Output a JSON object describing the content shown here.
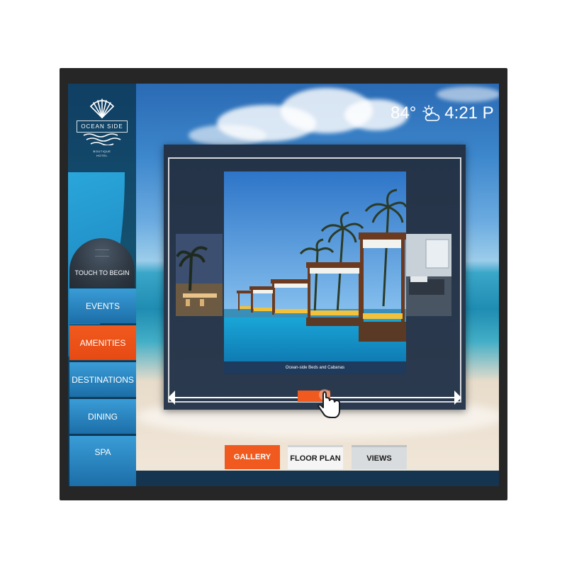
{
  "brand": {
    "name": "OCEAN SIDE",
    "subtitle_line1": "BOUTIQUE",
    "subtitle_line2": "HOTEL"
  },
  "header": {
    "temperature": "84°",
    "weather_icon": "partly-cloudy-icon",
    "time": "4:21 P"
  },
  "sidebar": {
    "touch_to_begin": "TOUCH TO BEGIN",
    "items": [
      {
        "label": "EVENTS",
        "active": false
      },
      {
        "label": "AMENITIES",
        "active": true
      },
      {
        "label": "DESTINATIONS",
        "active": false
      },
      {
        "label": "DINING",
        "active": false
      },
      {
        "label": "SPA",
        "active": false
      }
    ]
  },
  "gallery": {
    "caption": "Ocean-side Beds and Cabanas"
  },
  "tabs": [
    {
      "label": "GALLERY",
      "active": true
    },
    {
      "label": "FLOOR PLAN",
      "active": false
    },
    {
      "label": "VIEWS",
      "active": false
    }
  ],
  "colors": {
    "accent": "#f05a1e",
    "nav_blue": "#2a8ac6",
    "sidebar_dark": "#103f63"
  }
}
